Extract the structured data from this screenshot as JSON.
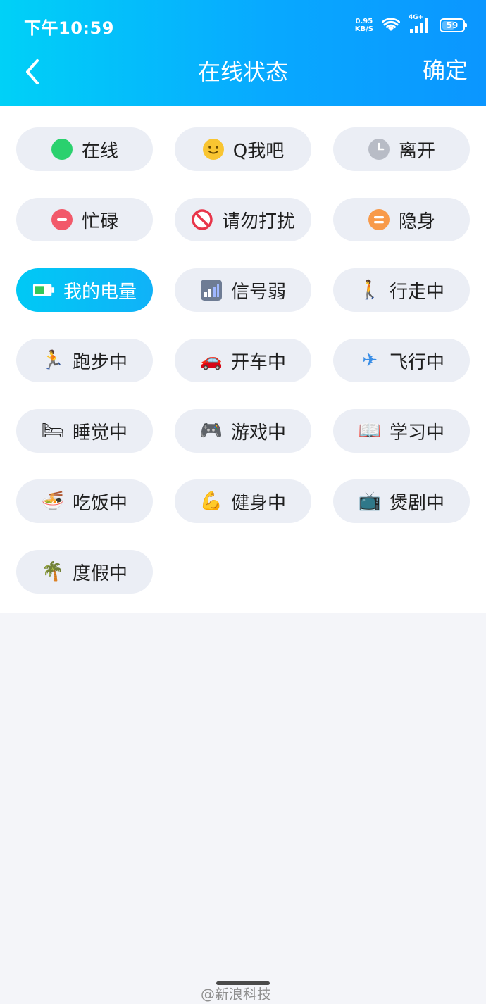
{
  "status_bar": {
    "time": "下午10:59",
    "net_speed_value": "0.95",
    "net_speed_unit": "KB/S",
    "network_type": "4G+",
    "battery_level": "59"
  },
  "nav": {
    "title": "在线状态",
    "confirm_label": "确定"
  },
  "statuses": [
    {
      "label": "在线",
      "icon": "green-dot-icon"
    },
    {
      "label": "Q我吧",
      "icon": "smile-face-icon"
    },
    {
      "label": "离开",
      "icon": "clock-icon"
    },
    {
      "label": "忙碌",
      "icon": "minus-circle-icon"
    },
    {
      "label": "请勿打扰",
      "icon": "no-entry-icon"
    },
    {
      "label": "隐身",
      "icon": "equals-circle-icon"
    },
    {
      "label": "我的电量",
      "icon": "battery-icon",
      "selected": true
    },
    {
      "label": "信号弱",
      "icon": "signal-bars-icon"
    },
    {
      "label": "行走中",
      "icon": "walking-icon"
    },
    {
      "label": "跑步中",
      "icon": "running-icon"
    },
    {
      "label": "开车中",
      "icon": "car-icon"
    },
    {
      "label": "飞行中",
      "icon": "airplane-icon"
    },
    {
      "label": "睡觉中",
      "icon": "bed-icon"
    },
    {
      "label": "游戏中",
      "icon": "gamepad-icon"
    },
    {
      "label": "学习中",
      "icon": "book-icon"
    },
    {
      "label": "吃饭中",
      "icon": "noodle-bowl-icon"
    },
    {
      "label": "健身中",
      "icon": "flexed-arm-icon"
    },
    {
      "label": "煲剧中",
      "icon": "tv-icon"
    },
    {
      "label": "度假中",
      "icon": "palm-tree-icon"
    }
  ],
  "watermark": "@新浪科技",
  "colors": {
    "header_start": "#00d1f7",
    "header_end": "#0b96ff",
    "chip_bg": "#ebeef5",
    "chip_selected": "#00c9f5"
  }
}
